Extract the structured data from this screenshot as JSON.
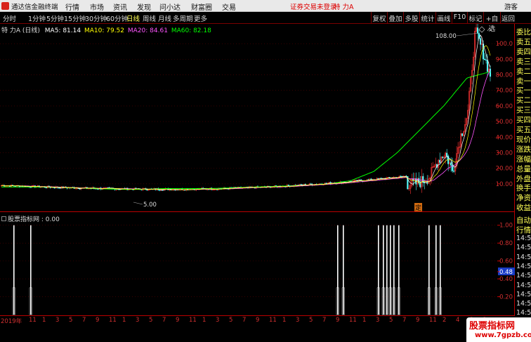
{
  "app": {
    "title": "通达信金融终端",
    "warning": "证券交易未登录",
    "stock_selector": "特 力A"
  },
  "menu": [
    "行情",
    "市场",
    "资讯",
    "发现",
    "问小达",
    "财富圈",
    "交易"
  ],
  "right_menu": [
    "游客",
    "功能",
    "新面",
    "公式",
    "选项"
  ],
  "periods": [
    "分时",
    "1分钟",
    "5分钟",
    "15分钟",
    "30分钟",
    "60分钟",
    "日线",
    "周线",
    "月线",
    "多周期",
    "更多"
  ],
  "active_period": "日线",
  "toolbar_buttons": [
    "复权",
    "叠加",
    "多股",
    "统计",
    "画线",
    "F10",
    "标记",
    "+自选",
    "返回"
  ],
  "main_legend": {
    "stock": "特 力A (日线)",
    "ma5": "MA5: 81.14",
    "ma10": "MA10: 79.52",
    "ma20": "MA20: 84.61",
    "ma60": "MA60: 82.18"
  },
  "indicator_legend": "股票指标网 : 0.00",
  "annotations": {
    "high": "108.00",
    "low": "5.00",
    "marker": "定"
  },
  "main_axis": [
    "100.0",
    "90.00",
    "80.00",
    "70.00",
    "60.00",
    "50.00",
    "40.00",
    "30.00",
    "20.00",
    "10.00"
  ],
  "ind_axis": [
    "1.00",
    "0.80",
    "0.60",
    "0.48",
    "0.40",
    "0.20"
  ],
  "right_panel": {
    "items": [
      "委比",
      "卖五",
      "卖四",
      "卖三",
      "卖二",
      "卖一",
      "买一",
      "买二",
      "买三",
      "买四",
      "买五",
      "现价",
      "涨跌",
      "涨幅",
      "总量",
      "外盘",
      "换手",
      "净资",
      "收益",
      "自动",
      "行情"
    ],
    "times": [
      "14:5",
      "14:5",
      "14:5",
      "14:5",
      "14:5",
      "14:5",
      "14:5",
      "14:5",
      "14:5"
    ]
  },
  "x_axis_labels": [
    "2019年",
    "11",
    "1",
    "3",
    "5",
    "7",
    "9",
    "11",
    "1",
    "3",
    "5",
    "7",
    "9",
    "11",
    "1",
    "3",
    "5",
    "7",
    "9",
    "11",
    "1",
    "3",
    "5",
    "7",
    "9",
    "11",
    "1",
    "3",
    "5",
    "7",
    "9",
    "11",
    "2",
    "4",
    "6",
    "8"
  ],
  "watermark": {
    "line1": "股票指标网",
    "line2": "www.7gpzb.com"
  },
  "colors": {
    "ma5": "#ffffff",
    "ma10": "#ffff00",
    "ma20": "#ff00ff",
    "ma60": "#00ff00",
    "up": "#ff3333",
    "down": "#55ffff",
    "axis": "#b00000"
  },
  "chart_data": {
    "type": "line",
    "title": "",
    "ylim": [
      0,
      110
    ],
    "series": [
      {
        "name": "MA60",
        "values": [
          8,
          8,
          8,
          7.5,
          7,
          6.5,
          6.5,
          7,
          7,
          7,
          7.5,
          8,
          8.5,
          9,
          10,
          12,
          18,
          30,
          45,
          60,
          78,
          82
        ]
      },
      {
        "name": "Price",
        "values": [
          7,
          9,
          8,
          7,
          6,
          5,
          5.5,
          7,
          7,
          7.5,
          8,
          9,
          10,
          10,
          12,
          15,
          25,
          30,
          18,
          40,
          55,
          108,
          95,
          80
        ]
      }
    ],
    "signal_series": {
      "name": "股票指标网",
      "values": [
        1,
        1,
        1,
        1,
        1,
        1,
        1,
        1,
        1,
        1,
        1,
        1,
        1,
        1,
        1,
        1,
        1
      ]
    }
  }
}
